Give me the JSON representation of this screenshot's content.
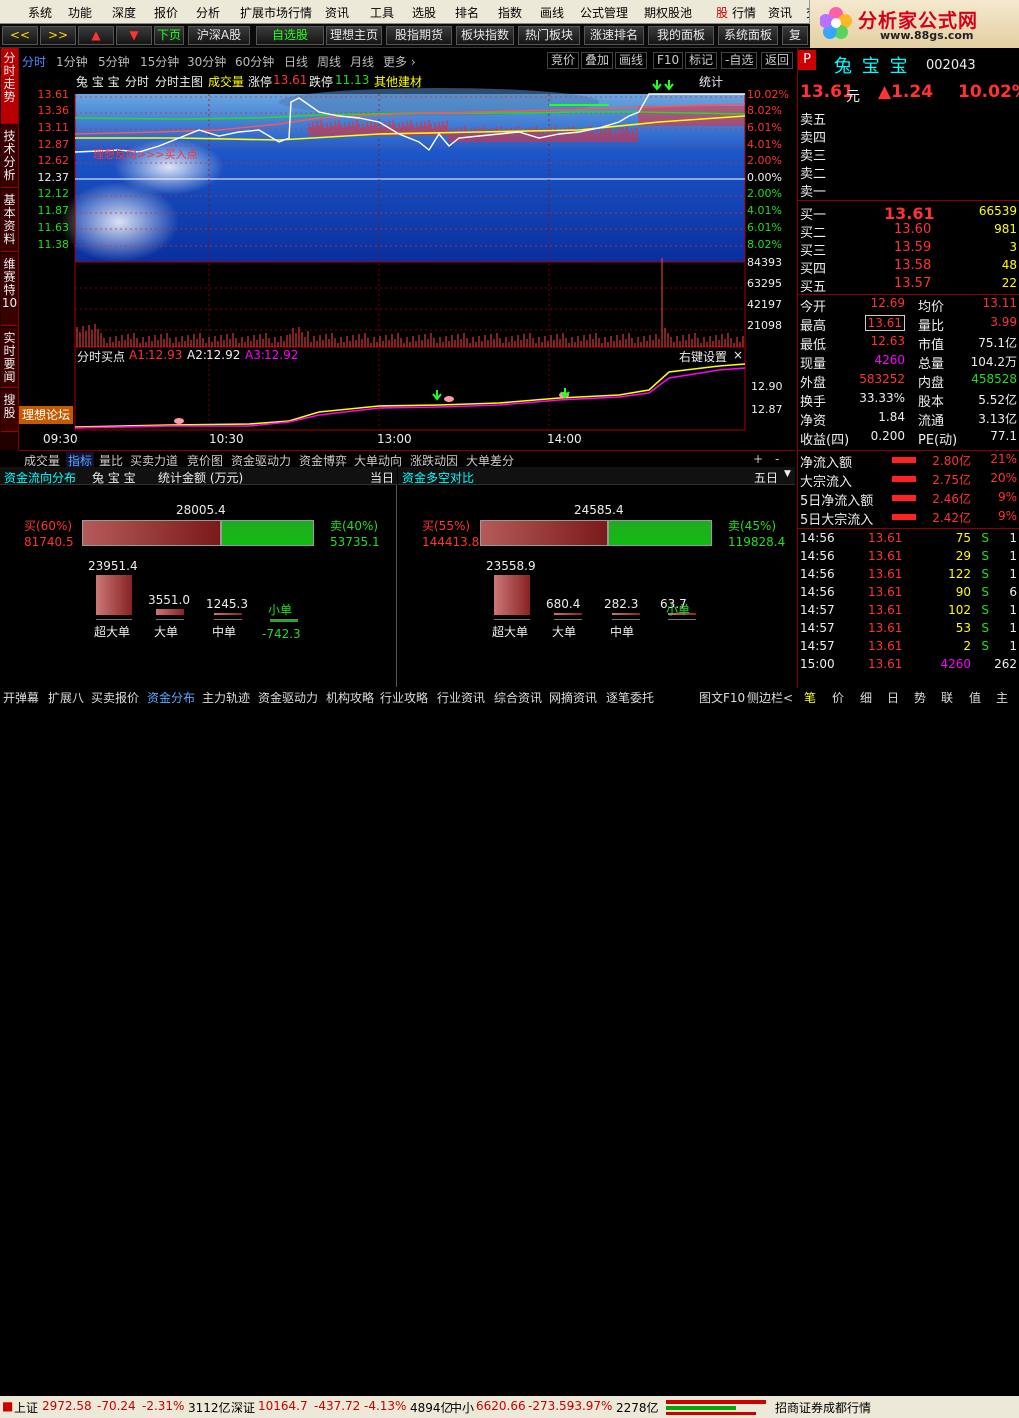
{
  "menu": [
    "系统",
    "功能",
    "深度",
    "报价",
    "分析",
    "扩展市场行情",
    "资讯",
    "工具",
    "选股",
    "排名",
    "指数",
    "画线",
    "公式管理",
    "期权股池",
    "股",
    "行情",
    "资讯",
    "交"
  ],
  "logo": {
    "title": "分析家公式网",
    "site": "www.88gs.com"
  },
  "toolbar": [
    "<<",
    ">>",
    "▲",
    "▼",
    "下页",
    "沪深A股",
    "自选股",
    "理想主页",
    "股指期货",
    "板块指数",
    "热门板块",
    "涨速排名",
    "我的面板",
    "系统面板",
    "复"
  ],
  "leftnav": [
    "分时走势",
    "技术分析",
    "基本资料",
    "维赛特10",
    "实时要闻",
    "搜股"
  ],
  "periods": [
    "分时",
    "1分钟",
    "5分钟",
    "15分钟",
    "30分钟",
    "60分钟",
    "日线",
    "周线",
    "月线",
    "更多 ›"
  ],
  "period_right": [
    "竞价",
    "叠加",
    "画线",
    "F10",
    "标记",
    "-自选",
    "返回"
  ],
  "chart_header": {
    "name": "兔 宝 宝",
    "items": [
      "分时",
      "分时主图"
    ],
    "vol": "成交量",
    "limit_up_label": "涨停",
    "limit_up": "13.61",
    "limit_down_label": "跌停",
    "limit_down": "11.13",
    "sector": "其他建材",
    "stat": "统计"
  },
  "price_axis": {
    "left": [
      "13.61",
      "13.36",
      "13.11",
      "12.87",
      "12.62",
      "12.37",
      "12.12",
      "11.87",
      "11.63",
      "11.38"
    ],
    "right": [
      "10.02%",
      "8.02%",
      "6.01%",
      "4.01%",
      "2.00%",
      "0.00%",
      "2.00%",
      "4.01%",
      "6.01%",
      "8.02%"
    ]
  },
  "vol_axis": [
    "84393",
    "63295",
    "42197",
    "21098"
  ],
  "annotation": "理想反向>>>买入点",
  "sub": {
    "title": "分时买点",
    "a1_label": "A1:",
    "a1": "12.93",
    "a2_label": "A2:",
    "a2": "12.92",
    "a3_label": "A3:",
    "a3": "12.92",
    "settings": "右键设置",
    "close": "×",
    "axis": [
      "12.90",
      "12.87"
    ]
  },
  "forum_label": "理想论坛",
  "time_axis": [
    "09:30",
    "10:30",
    "13:00",
    "14:00"
  ],
  "bottom_tabs": [
    "成交量",
    "指标",
    "量比",
    "买卖力道",
    "竞价图",
    "资金驱动力",
    "资金博弈",
    "大单动向",
    "涨跌动因",
    "大单差分"
  ],
  "bottom_tab_ctrl": [
    "+",
    "-"
  ],
  "fund_left": {
    "title": "资金流向分布",
    "name": "兔 宝 宝",
    "sub": "统计金额 (万元)",
    "period": "当日",
    "buy_label": "买(60%)",
    "buy": "81740.5",
    "total": "28005.4",
    "sell_label": "卖(40%)",
    "sell": "53735.1",
    "buy_pct": 60,
    "bars": [
      {
        "label": "超大单",
        "value": "23951.4",
        "num": 23951.4
      },
      {
        "label": "大单",
        "value": "3551.0",
        "num": 3551.0
      },
      {
        "label": "中单",
        "value": "1245.3",
        "num": 1245.3
      },
      {
        "label": "小单",
        "value": "-742.3",
        "num": -742.3
      }
    ]
  },
  "fund_right": {
    "title": "资金多空对比",
    "period": "五日",
    "buy_label": "买(55%)",
    "buy": "144413.8",
    "total": "24585.4",
    "sell_label": "卖(45%)",
    "sell": "119828.4",
    "buy_pct": 55,
    "bars": [
      {
        "label": "超大单",
        "value": "23558.9",
        "num": 23558.9
      },
      {
        "label": "大单",
        "value": "680.4",
        "num": 680.4
      },
      {
        "label": "中单",
        "value": "282.3",
        "num": 282.3
      },
      {
        "label": "小单",
        "value": "63.7",
        "num": 63.7
      }
    ]
  },
  "quote": {
    "name": "兔 宝 宝",
    "code": "002043",
    "price": "13.61",
    "unit": "元",
    "change": "▲1.24",
    "pct": "10.02%",
    "sells": [
      "卖五",
      "卖四",
      "卖三",
      "卖二",
      "卖一"
    ],
    "buys": [
      {
        "label": "买一",
        "price": "13.61",
        "vol": "66539"
      },
      {
        "label": "买二",
        "price": "13.60",
        "vol": "981"
      },
      {
        "label": "买三",
        "price": "13.59",
        "vol": "3"
      },
      {
        "label": "买四",
        "price": "13.58",
        "vol": "48"
      },
      {
        "label": "买五",
        "price": "13.57",
        "vol": "22"
      }
    ],
    "stats": [
      {
        "l1": "今开",
        "v1": "12.69",
        "c1": "up",
        "l2": "均价",
        "v2": "13.11",
        "c2": "up"
      },
      {
        "l1": "最高",
        "v1": "13.61",
        "c1": "up",
        "l2": "量比",
        "v2": "3.99",
        "c2": "up"
      },
      {
        "l1": "最低",
        "v1": "12.63",
        "c1": "up",
        "l2": "市值",
        "v2": "75.1亿",
        "c2": "wh"
      },
      {
        "l1": "现量",
        "v1": "4260",
        "c1": "mg",
        "l2": "总量",
        "v2": "104.2万",
        "c2": "wh"
      },
      {
        "l1": "外盘",
        "v1": "583252",
        "c1": "up",
        "l2": "内盘",
        "v2": "458528",
        "c2": "dn"
      },
      {
        "l1": "换手",
        "v1": "33.33%",
        "c1": "wh",
        "l2": "股本",
        "v2": "5.52亿",
        "c2": "wh"
      },
      {
        "l1": "净资",
        "v1": "1.84",
        "c1": "wh",
        "l2": "流通",
        "v2": "3.13亿",
        "c2": "wh"
      },
      {
        "l1": "收益(四)",
        "v1": "0.200",
        "c1": "wh",
        "l2": "PE(动)",
        "v2": "77.1",
        "c2": "wh"
      }
    ],
    "flows": [
      {
        "label": "净流入额",
        "value": "2.80亿",
        "pct": "21%"
      },
      {
        "label": "大宗流入",
        "value": "2.75亿",
        "pct": "20%"
      },
      {
        "label": "5日净流入额",
        "value": "2.46亿",
        "pct": "9%"
      },
      {
        "label": "5日大宗流入",
        "value": "2.42亿",
        "pct": "9%"
      }
    ],
    "ticks": [
      {
        "t": "14:56",
        "p": "13.61",
        "v": "75",
        "s": "S",
        "x": "1"
      },
      {
        "t": "14:56",
        "p": "13.61",
        "v": "29",
        "s": "S",
        "x": "1"
      },
      {
        "t": "14:56",
        "p": "13.61",
        "v": "122",
        "s": "S",
        "x": "1"
      },
      {
        "t": "14:56",
        "p": "13.61",
        "v": "90",
        "s": "S",
        "x": "6"
      },
      {
        "t": "14:57",
        "p": "13.61",
        "v": "102",
        "s": "S",
        "x": "1"
      },
      {
        "t": "14:57",
        "p": "13.61",
        "v": "53",
        "s": "S",
        "x": "1"
      },
      {
        "t": "14:57",
        "p": "13.61",
        "v": "2",
        "s": "S",
        "x": "1"
      },
      {
        "t": "15:00",
        "p": "13.61",
        "v": "4260",
        "s": "",
        "x": "262"
      }
    ]
  },
  "status_tabs": [
    "开弹幕",
    "扩展八",
    "买卖报价",
    "资金分布",
    "主力轨迹",
    "资金驱动力",
    "机构攻略",
    "行业攻略",
    "行业资讯",
    "综合资讯",
    "网摘资讯",
    "逐笔委托"
  ],
  "status_right": [
    "图文F10",
    "侧边栏<",
    "笔",
    "价",
    "细",
    "日",
    "势",
    "联",
    "值",
    "主"
  ],
  "index": {
    "sh_label": "上证",
    "sh": "2972.58",
    "sh_chg": "-70.24",
    "sh_pct": "-2.31%",
    "sh_amt": "3112亿",
    "sz_label": "深证",
    "sz": "10164.7",
    "sz_chg": "-437.72",
    "sz_pct": "-4.13%",
    "sz_amt": "4894亿",
    "zx_label": "中小",
    "zx": "6620.66",
    "zx_chg": "-273.59",
    "zx_pct": "-3.97%",
    "zx_amt": "2278亿",
    "broker": "招商证券成都行情"
  },
  "colors": {
    "up": "#ff3333",
    "down": "#22dd22",
    "bg": "#000000",
    "border": "#880000"
  }
}
